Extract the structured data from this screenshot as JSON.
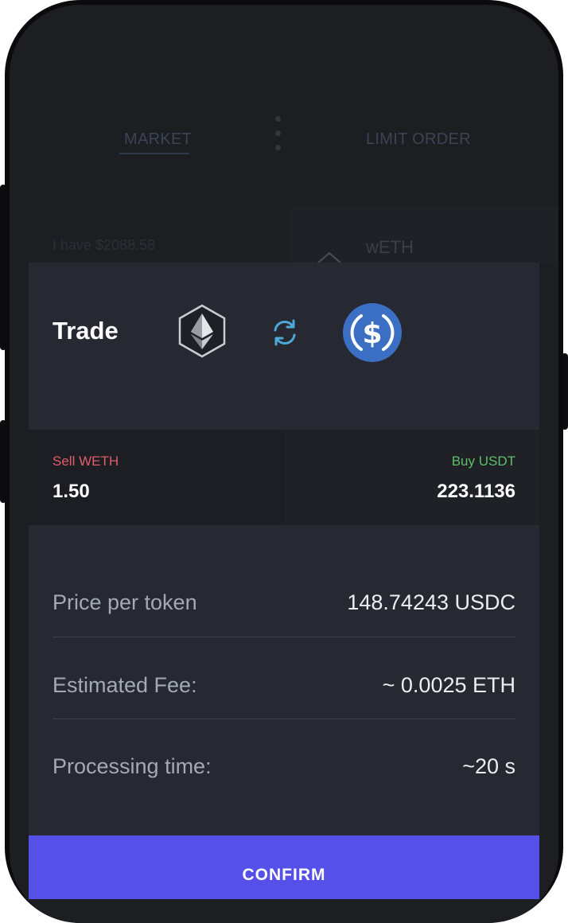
{
  "tabs": {
    "market": "MARKET",
    "limit_order": "LIMIT ORDER"
  },
  "background": {
    "have_balance": "I have $2088.58",
    "token": "wETH"
  },
  "modal": {
    "title": "Trade",
    "icons": {
      "from": "ethereum-icon",
      "swap": "swap-arrows-icon",
      "to": "usdc-icon"
    },
    "sell": {
      "label": "Sell WETH",
      "amount": "1.50"
    },
    "buy": {
      "label": "Buy USDT",
      "amount": "223.1136"
    },
    "details": [
      {
        "label": "Price per token",
        "value": "148.74243 USDC"
      },
      {
        "label": "Estimated Fee:",
        "value": "~ 0.0025 ETH"
      },
      {
        "label": "Processing time:",
        "value": "~20 s"
      }
    ],
    "confirm_label": "CONFIRM"
  },
  "colors": {
    "sell": "#e05d6b",
    "buy": "#5dbf6a",
    "accent": "#5550e8",
    "usdc": "#3a6fc4",
    "swap": "#4fa8d8"
  }
}
